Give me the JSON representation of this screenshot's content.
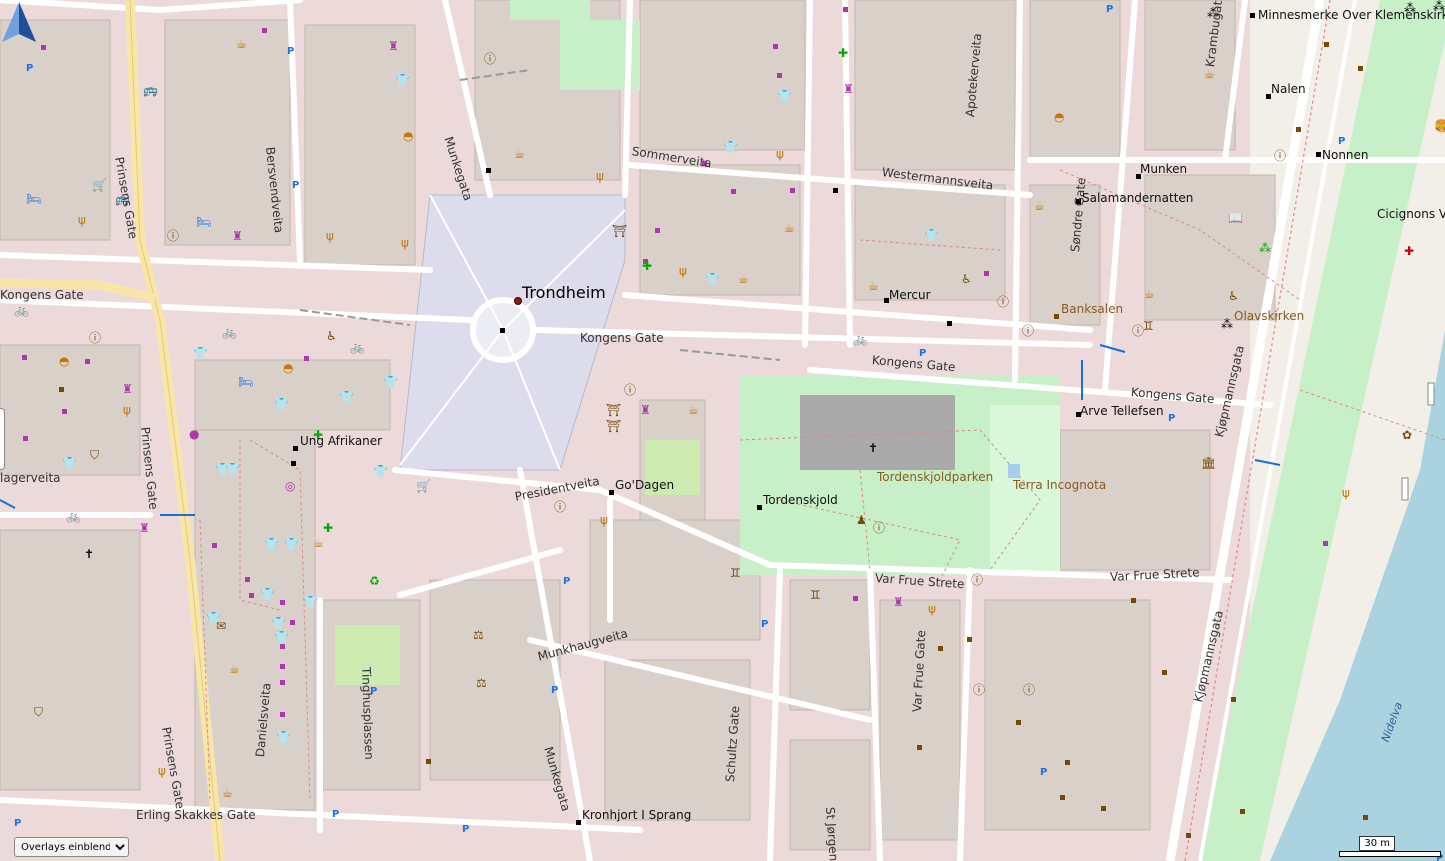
{
  "map": {
    "city_label": "Trondheim",
    "streets": [
      "Prinsens Gate",
      "Bersvendveita",
      "Munkegata",
      "Sommerveita",
      "Westermannsveita",
      "Apotekerveita",
      "Krambugata",
      "Søndre Gate",
      "Kongens Gate",
      "Kongens Gate",
      "Kongens Gate",
      "Kongens Gate",
      "Prinsens Gate",
      "Presidentveita",
      "Var Frue Strete",
      "Var Frue Strete",
      "Munkhaugveita",
      "Tinghusplassen",
      "Munkegata",
      "Schultz Gate",
      "St Jørgensveita",
      "Var Frue Gate",
      "Danielsveita",
      "Prinsens Gate",
      "Erling Skakkes Gate",
      "Kjøpmannsgata",
      "Kjøpmannsgata",
      "lagerveita"
    ],
    "pois": [
      "Minnesmerke Over Klemenskirken",
      "Nalen",
      "Nonnen",
      "Munken",
      "Salamandernatten",
      "Cicignons V",
      "Banksalen",
      "Olavskirken",
      "Mercur",
      "Arve Tellefsen",
      "Ung Afrikaner",
      "Go'Dagen",
      "Tordenskjold",
      "Tordenskjoldparken",
      "Terra Incognota",
      "Kronhjort I Sprang"
    ],
    "water_label": "Nidelva"
  },
  "controls": {
    "overlay_select": "Overlays einblenden",
    "scale": "30 m",
    "compass": "north-arrow-icon"
  },
  "colors": {
    "land": "#f2efe9",
    "built": "#d9d0c9",
    "residential": "#eddede",
    "square": "#dcdcec",
    "park": "#c8f0c8",
    "water": "#aad3df",
    "poi_magenta": "#ac39ac",
    "poi_brown": "#c77400"
  }
}
